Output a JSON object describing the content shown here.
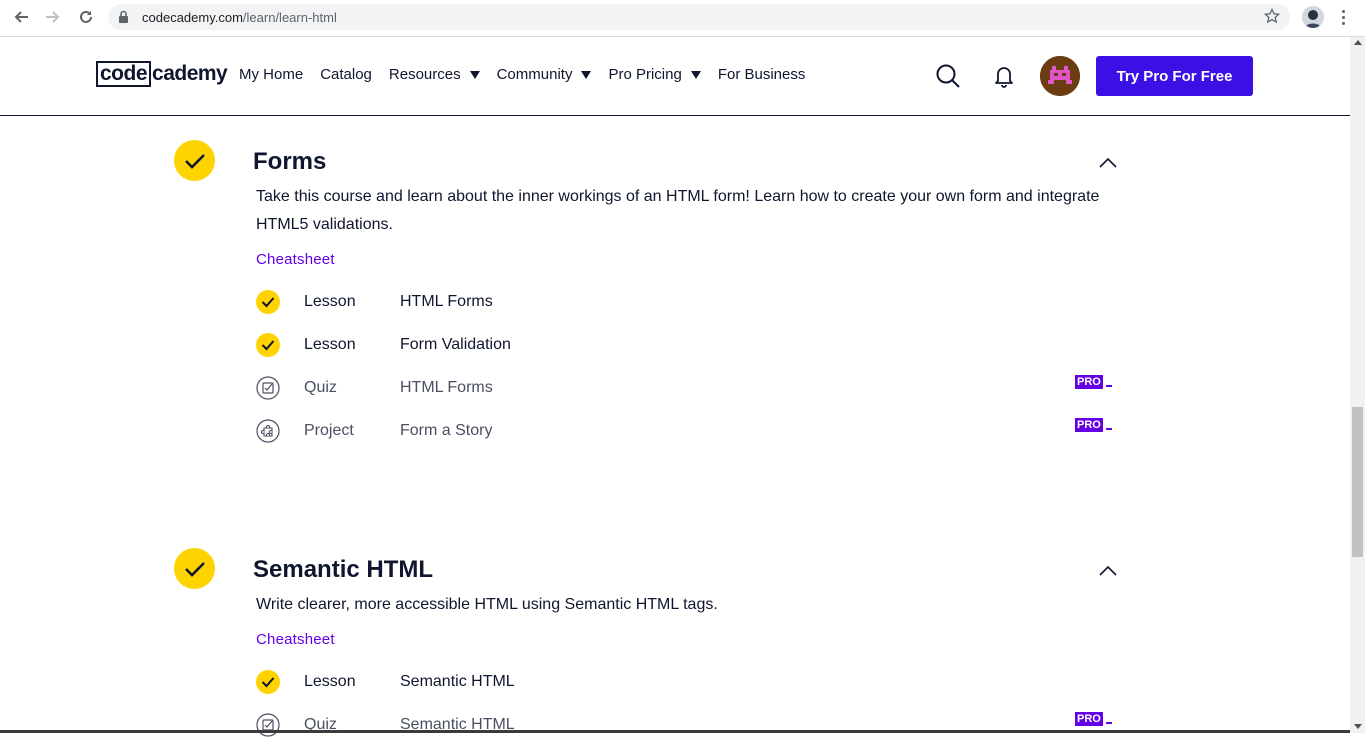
{
  "browser": {
    "url_host": "codecademy.com",
    "url_path": "/learn/learn-html"
  },
  "header": {
    "logo_code": "code",
    "logo_rest": "cademy",
    "nav": [
      {
        "label": "My Home",
        "dropdown": false
      },
      {
        "label": "Catalog",
        "dropdown": false
      },
      {
        "label": "Resources",
        "dropdown": true
      },
      {
        "label": "Community",
        "dropdown": true
      },
      {
        "label": "Pro Pricing",
        "dropdown": true
      },
      {
        "label": "For Business",
        "dropdown": false
      }
    ],
    "cta": "Try Pro For Free"
  },
  "modules": [
    {
      "title": "Forms",
      "description": "Take this course and learn about the inner workings of an HTML form! Learn how to create your own form and integrate HTML5 validations.",
      "cheatsheet": "Cheatsheet",
      "items": [
        {
          "type": "Lesson",
          "name": "HTML Forms",
          "completed": true,
          "pro": false
        },
        {
          "type": "Lesson",
          "name": "Form Validation",
          "completed": true,
          "pro": false
        },
        {
          "type": "Quiz",
          "name": "HTML Forms",
          "completed": false,
          "pro": true
        },
        {
          "type": "Project",
          "name": "Form a Story",
          "completed": false,
          "pro": true
        }
      ]
    },
    {
      "title": "Semantic HTML",
      "description": "Write clearer, more accessible HTML using Semantic HTML tags.",
      "cheatsheet": "Cheatsheet",
      "items": [
        {
          "type": "Lesson",
          "name": "Semantic HTML",
          "completed": true,
          "pro": false
        },
        {
          "type": "Quiz",
          "name": "Semantic HTML",
          "completed": false,
          "pro": true
        }
      ]
    }
  ],
  "pro_badge": "PRO",
  "colors": {
    "accent": "#3a10e5",
    "check_yellow": "#ffd300",
    "cheatsheet_purple": "#6400e4",
    "text_navy": "#10162f"
  }
}
